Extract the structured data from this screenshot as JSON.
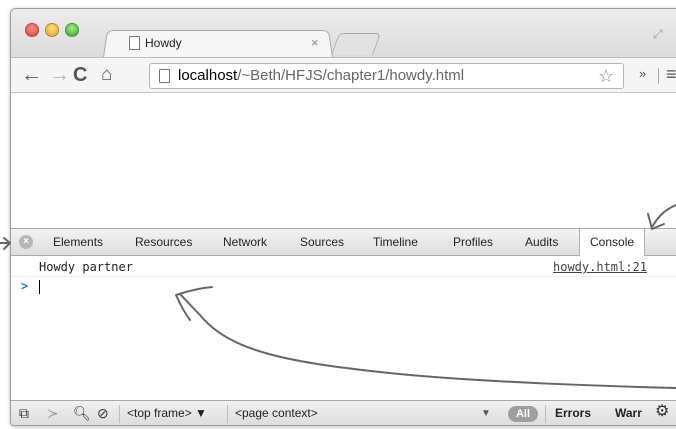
{
  "browser": {
    "tab_title": "Howdy",
    "tab_close": "×",
    "url_host": "localhost",
    "url_path": "/~Beth/HFJS/chapter1/howdy.html",
    "nav": {
      "back": "←",
      "forward": "→",
      "reload": "C",
      "home": "⌂"
    },
    "star": "☆",
    "extra": "»",
    "menu": "≡"
  },
  "devtools": {
    "close": "×",
    "tabs": [
      "Elements",
      "Resources",
      "Network",
      "Sources",
      "Timeline",
      "Profiles",
      "Audits",
      "Console"
    ],
    "active_tab": "Console",
    "console": {
      "log_text": "Howdy partner",
      "log_source": "howdy.html:21",
      "prompt_symbol": ">"
    },
    "status": {
      "frame_select": "<top frame> ▼",
      "context_select": "<page context>",
      "filter_arrow": "▼",
      "filter_all": "All",
      "filter_errors": "Errors",
      "filter_warnings": "Warr"
    }
  }
}
